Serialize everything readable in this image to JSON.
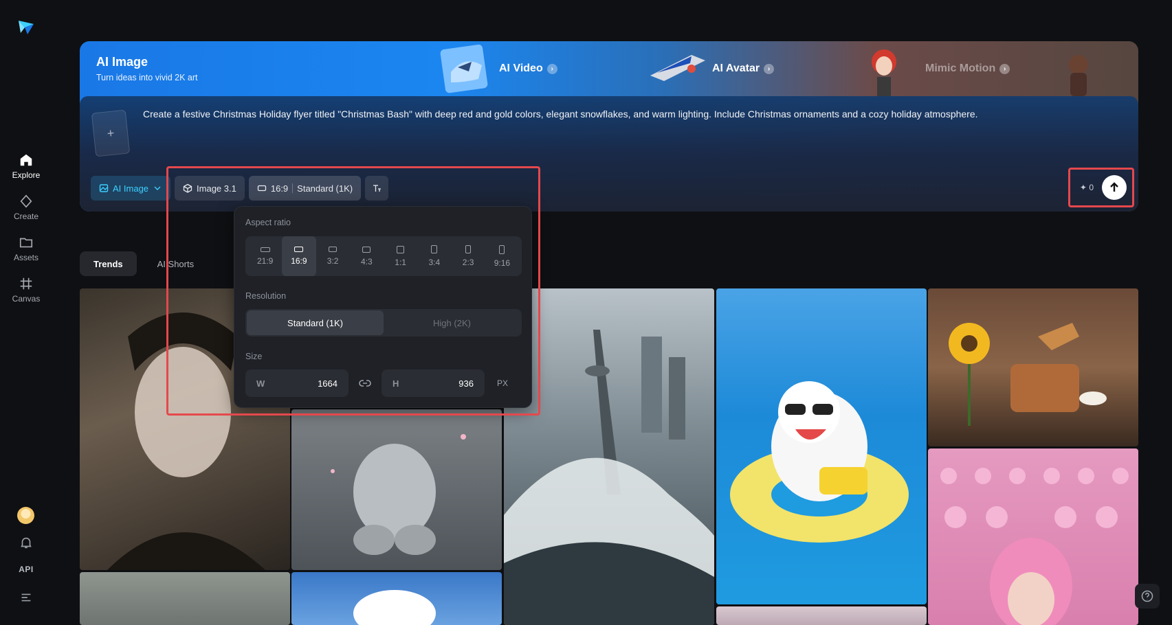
{
  "sidebar": {
    "items": [
      {
        "label": "Explore",
        "icon": "home-icon"
      },
      {
        "label": "Create",
        "icon": "diamond-icon"
      },
      {
        "label": "Assets",
        "icon": "folder-icon"
      },
      {
        "label": "Canvas",
        "icon": "frame-icon"
      }
    ],
    "api_label": "API"
  },
  "banner": {
    "title": "AI Image",
    "subtitle": "Turn ideas into vivid 2K art",
    "promos": [
      {
        "label": "AI Video"
      },
      {
        "label": "AI Avatar"
      },
      {
        "label": "Mimic Motion"
      }
    ]
  },
  "prompt": {
    "text": "Create a festive Christmas Holiday flyer titled \"Christmas Bash\" with deep red and gold colors, elegant snowflakes, and warm lighting. Include Christmas ornaments and a cozy holiday atmosphere."
  },
  "toolbar": {
    "mode_label": "AI Image",
    "model_label": "Image 3.1",
    "ratio_label": "16:9",
    "quality_label": "Standard (1K)"
  },
  "send": {
    "credits": "0"
  },
  "dropdown": {
    "aspect_label": "Aspect ratio",
    "ratios": [
      "21:9",
      "16:9",
      "3:2",
      "4:3",
      "1:1",
      "3:4",
      "2:3",
      "9:16"
    ],
    "selected_ratio": "16:9",
    "resolution_label": "Resolution",
    "resolutions": [
      "Standard (1K)",
      "High (2K)"
    ],
    "size_label": "Size",
    "width_key": "W",
    "width_value": "1664",
    "height_key": "H",
    "height_value": "936",
    "unit": "PX"
  },
  "tabs": [
    {
      "label": "Trends"
    },
    {
      "label": "AI Shorts"
    }
  ],
  "colors": {
    "accent": "#3cd0ff",
    "highlight": "#e5484d",
    "background": "#0f1013"
  }
}
